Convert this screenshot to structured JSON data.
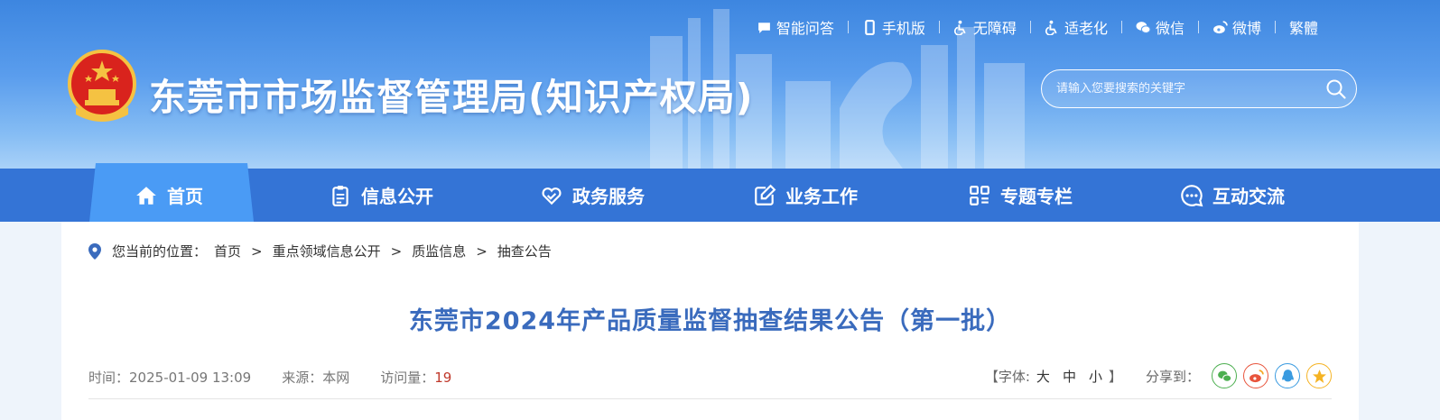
{
  "header": {
    "site_title": "东莞市市场监督管理局(知识产权局)",
    "toplinks": [
      {
        "label": "智能问答",
        "icon": "chat-bubble-icon"
      },
      {
        "label": "手机版",
        "icon": "mobile-icon"
      },
      {
        "label": "无障碍",
        "icon": "accessibility-icon"
      },
      {
        "label": "适老化",
        "icon": "elderly-care-icon"
      },
      {
        "label": "微信",
        "icon": "wechat-icon"
      },
      {
        "label": "微博",
        "icon": "weibo-icon"
      },
      {
        "label": "繁體",
        "icon": ""
      }
    ],
    "search_placeholder": "请输入您要搜索的关键字"
  },
  "nav": {
    "items": [
      {
        "label": "首页",
        "icon": "home-icon",
        "active": true
      },
      {
        "label": "信息公开",
        "icon": "clipboard-icon"
      },
      {
        "label": "政务服务",
        "icon": "heart-hands-icon"
      },
      {
        "label": "业务工作",
        "icon": "edit-icon"
      },
      {
        "label": "专题专栏",
        "icon": "grid-icon"
      },
      {
        "label": "互动交流",
        "icon": "chat-dots-icon"
      }
    ]
  },
  "breadcrumb": {
    "prefix": "您当前的位置：",
    "items": [
      "首页",
      "重点领域信息公开",
      "质监信息",
      "抽查公告"
    ],
    "separator": ">"
  },
  "article": {
    "title": "东莞市2024年产品质量监督抽查结果公告（第一批）",
    "time_label": "时间：",
    "time": "2025-01-09 13:09",
    "source_label": "来源：",
    "source": "本网",
    "views_label": "访问量：",
    "views": "19"
  },
  "tools": {
    "font_open": "【字体:",
    "font_sizes": [
      "大",
      "中",
      "小"
    ],
    "font_close": "】",
    "share_label": "分享到："
  },
  "colors": {
    "header_blue": "#3d86e0",
    "nav_blue": "#3474d6",
    "nav_active": "#4a9bf5",
    "title_blue": "#3a6bbd",
    "wechat": "#4caf50",
    "weibo": "#e8543c",
    "qq": "#3a9be0",
    "qzone": "#f5b324"
  }
}
